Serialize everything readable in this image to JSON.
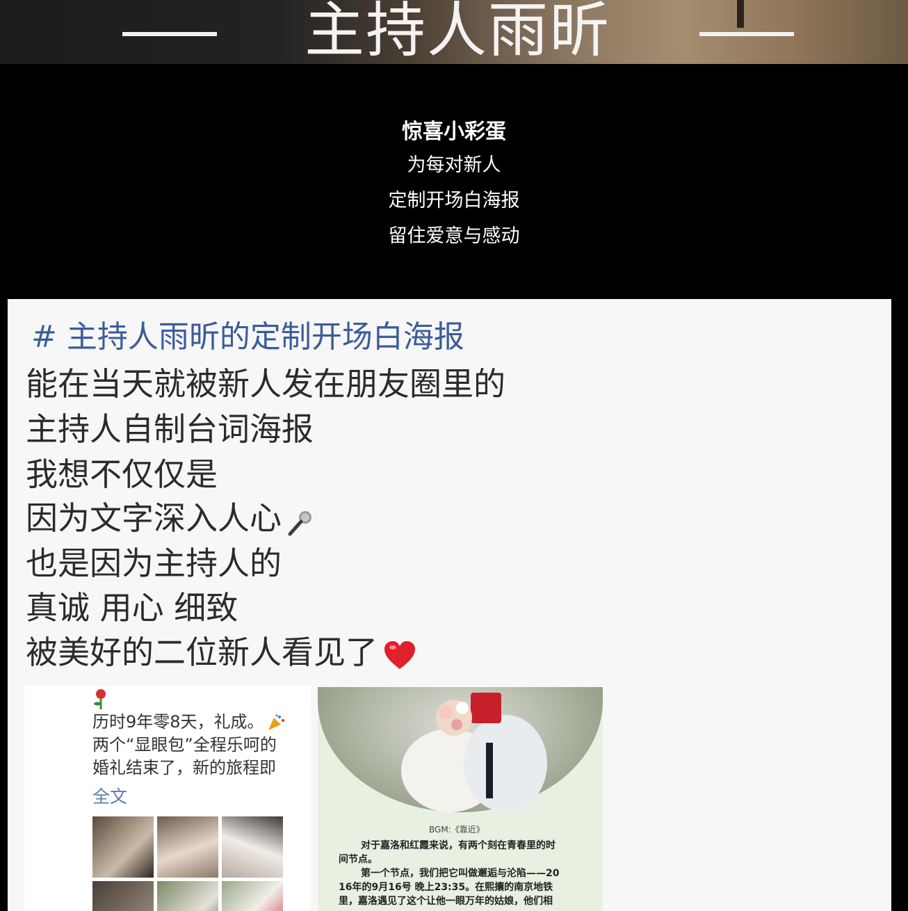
{
  "banner": {
    "title": "主持人雨昕"
  },
  "intro": {
    "heading": "惊喜小彩蛋",
    "lines": [
      "为每对新人",
      "定制开场白海报",
      "留住爱意与感动"
    ]
  },
  "post": {
    "hashtag": "# 主持人雨昕的定制开场白海报",
    "lines": [
      "能在当天就被新人发在朋友圈里的",
      "主持人自制台词海报",
      "我想不仅仅是",
      "因为文字深入人心",
      "也是因为主持人的",
      "真诚 用心 细致",
      "被美好的二位新人看见了"
    ],
    "icons": {
      "mic": "microphone-icon",
      "heart": "heart-icon",
      "rose": "rose-icon",
      "party": "party-popper-icon"
    }
  },
  "moment": {
    "text_lines": [
      "历时9年零8天，礼成。",
      "两个“显眼包”全程乐呵的",
      "婚礼结束了，新的旅程即"
    ],
    "more": "全文"
  },
  "poster": {
    "bgm": "BGM:《靠近》",
    "paragraphs": [
      "对于嘉洛和红霞来说，有两个刻在青春里的时",
      "间节点。",
      "第一个节点，我们把它叫做邂逅与沦陷——20",
      "16年的9月16号 晚上23:35。在熙攘的南京地铁",
      "里，嘉洛遇见了这个让他一眼万年的姑娘，他们相"
    ]
  },
  "colors": {
    "hashtag": "#3b5d99",
    "link": "#5c7bab",
    "heart": "#e0202a"
  }
}
